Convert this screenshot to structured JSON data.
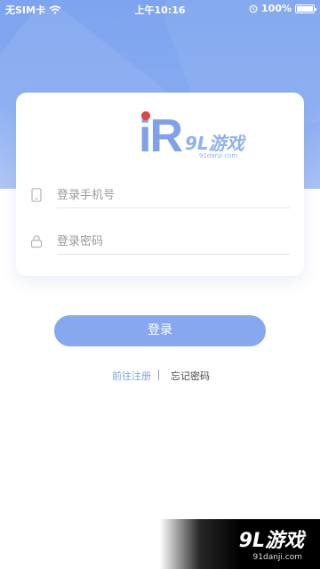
{
  "status_bar": {
    "carrier": "无SIM卡",
    "time": "上午10:16",
    "battery": "100%"
  },
  "logo": {
    "mark": "iR",
    "brand": "9L游戏",
    "domain": "91danji.com"
  },
  "form": {
    "phone_placeholder": "登录手机号",
    "password_placeholder": "登录密码"
  },
  "actions": {
    "login_label": "登录",
    "register_label": "前往注册",
    "forgot_label": "忘记密码"
  },
  "watermark": {
    "brand": "9L游戏",
    "domain": "91danji.com"
  },
  "colors": {
    "primary": "#87a8ee",
    "link": "#7ea1e8",
    "logo_dot": "#e0443b"
  },
  "icons": [
    "wifi-icon",
    "alarm-icon",
    "battery-icon",
    "phone-icon",
    "lock-icon"
  ]
}
